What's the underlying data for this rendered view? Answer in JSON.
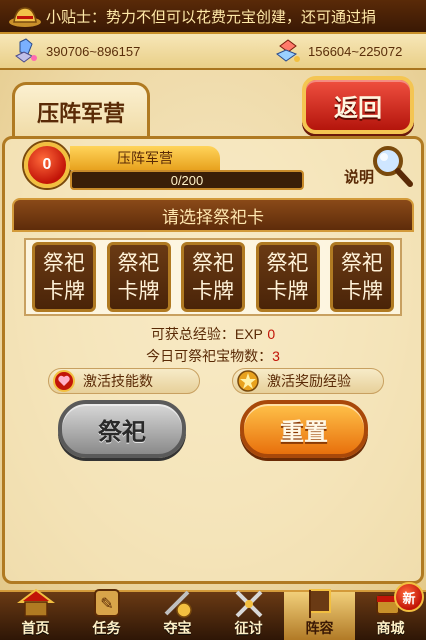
{
  "tip": {
    "text": "小贴士：势力不但可以花费元宝创建，还可通过捐"
  },
  "resources": {
    "left": "390706~896157",
    "right": "156604~225072"
  },
  "header": {
    "title": "压阵军营",
    "back_label": "返回"
  },
  "camp": {
    "level": "0",
    "name": "压阵军营",
    "exp_text": "0/200",
    "exp_progress": 0,
    "explain_label": "说明"
  },
  "card_select": {
    "title": "请选择祭祀卡",
    "cards": [
      "祭祀\n卡牌",
      "祭祀\n卡牌",
      "祭祀\n卡牌",
      "祭祀\n卡牌",
      "祭祀\n卡牌"
    ]
  },
  "stats": {
    "total_exp_label": "可获总经验：",
    "total_exp_unit": "EXP",
    "total_exp_value": "0",
    "daily_label": "今日可祭祀宝物数：",
    "daily_value": "3"
  },
  "toggles": {
    "skill_label": "激活技能数",
    "reward_label": "激活奖励经验"
  },
  "actions": {
    "sacrifice_label": "祭祀",
    "reset_label": "重置"
  },
  "nav": {
    "items": [
      {
        "label": "首页",
        "icon": "home-icon"
      },
      {
        "label": "任务",
        "icon": "task-icon"
      },
      {
        "label": "夺宝",
        "icon": "treasure-icon"
      },
      {
        "label": "征讨",
        "icon": "swords-icon"
      },
      {
        "label": "阵容",
        "icon": "formation-icon"
      },
      {
        "label": "商城",
        "icon": "shop-icon"
      }
    ],
    "active_index": 4,
    "new_badge": "新"
  },
  "colors": {
    "accent_red": "#c21408",
    "gold": "#f2bf40",
    "brown": "#5a2a06"
  }
}
